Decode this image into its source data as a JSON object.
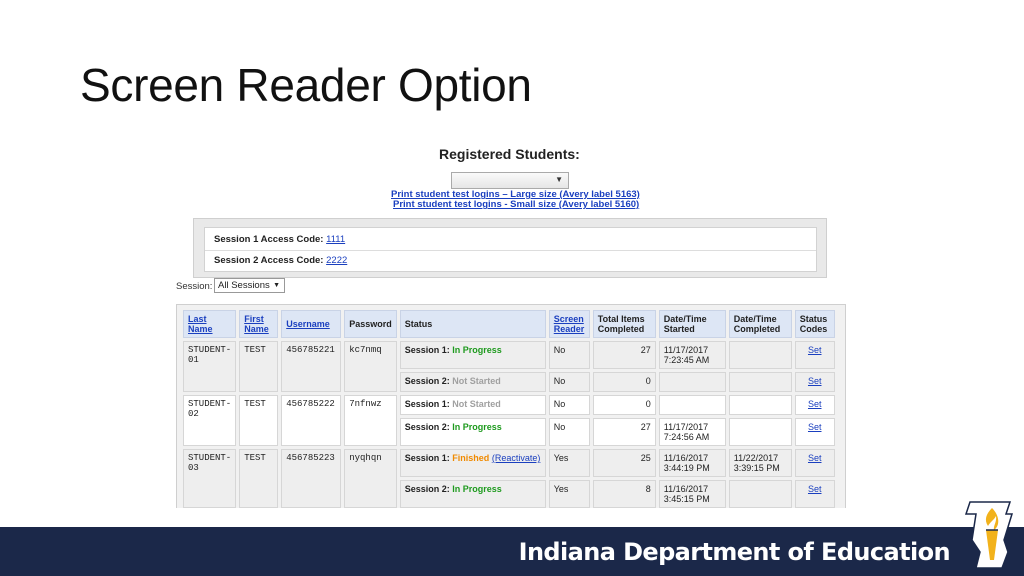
{
  "slide": {
    "title": "Screen Reader Option"
  },
  "screenshot": {
    "registered_title": "Registered Students:",
    "print_links": [
      "Print student test logins – Large size (Avery label 5163)",
      "Print student test logins - Small size (Avery label 5160)"
    ],
    "access_codes": [
      {
        "label": "Session 1 Access Code:",
        "code": "1111"
      },
      {
        "label": "Session 2 Access Code:",
        "code": "2222"
      }
    ],
    "session_filter": {
      "label": "Session:",
      "value": "All Sessions"
    },
    "table": {
      "headers": [
        "Last Name",
        "First Name",
        "Username",
        "Password",
        "Status",
        "Screen Reader",
        "Total Items Completed",
        "Date/Time Started",
        "Date/Time Completed",
        "Status Codes"
      ],
      "students": [
        {
          "last": "STUDENT-01",
          "first": "TEST",
          "username": "456785221",
          "password": "kc7nmq",
          "sessions": [
            {
              "label": "Session 1:",
              "status": "In Progress",
              "reactivate": "",
              "screen_reader": "No",
              "items": "27",
              "started": "11/17/2017 7:23:45 AM",
              "completed": "",
              "code": "Set"
            },
            {
              "label": "Session 2:",
              "status": "Not Started",
              "reactivate": "",
              "screen_reader": "No",
              "items": "0",
              "started": "",
              "completed": "",
              "code": "Set"
            }
          ]
        },
        {
          "last": "STUDENT-02",
          "first": "TEST",
          "username": "456785222",
          "password": "7nfnwz",
          "sessions": [
            {
              "label": "Session 1:",
              "status": "Not Started",
              "reactivate": "",
              "screen_reader": "No",
              "items": "0",
              "started": "",
              "completed": "",
              "code": "Set"
            },
            {
              "label": "Session 2:",
              "status": "In Progress",
              "reactivate": "",
              "screen_reader": "No",
              "items": "27",
              "started": "11/17/2017 7:24:56 AM",
              "completed": "",
              "code": "Set"
            }
          ]
        },
        {
          "last": "STUDENT-03",
          "first": "TEST",
          "username": "456785223",
          "password": "nyqhqn",
          "sessions": [
            {
              "label": "Session 1:",
              "status": "Finished",
              "reactivate": "(Reactivate)",
              "screen_reader": "Yes",
              "items": "25",
              "started": "11/16/2017 3:44:19 PM",
              "completed": "11/22/2017 3:39:15 PM",
              "code": "Set"
            },
            {
              "label": "Session 2:",
              "status": "In Progress",
              "reactivate": "",
              "screen_reader": "Yes",
              "items": "8",
              "started": "11/16/2017 3:45:15 PM",
              "completed": "",
              "code": "Set"
            }
          ]
        }
      ]
    }
  },
  "footer": {
    "org_name": "Indiana Department of Education",
    "logo_icon": "torch-icon"
  },
  "colors": {
    "footer_bg": "#1b2849",
    "link": "#1a3fbf",
    "in_progress": "#1e9a1e",
    "finished": "#f08a00",
    "not_started": "#a0a0a0",
    "header_bg": "#dde6f5"
  }
}
